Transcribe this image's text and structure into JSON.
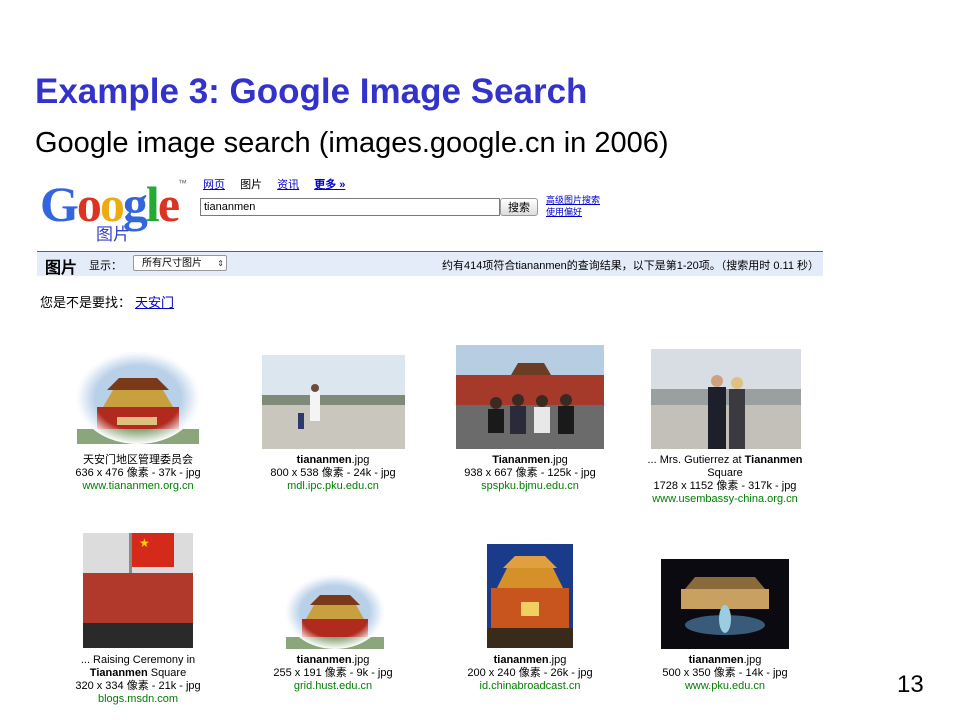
{
  "slide": {
    "title": "Example 3: Google Image Search",
    "subtitle": "Google image search (images.google.cn  in 2006)",
    "page_number": "13"
  },
  "logo": {
    "text": "Google",
    "subtitle": "图片",
    "tm": "™"
  },
  "tabs": {
    "web": "网页",
    "images": "图片",
    "news": "资讯",
    "more": "更多 »"
  },
  "search": {
    "query": "tiananmen",
    "button_label": "搜索"
  },
  "advanced": {
    "advanced_image_search": "高级图片搜索",
    "preferences": "使用偏好"
  },
  "results_bar": {
    "label": "图片",
    "show_label": "显示：",
    "size_filter": "所有尺寸图片",
    "stats": "约有414项符合tiananmen的查询结果，以下是第1-20项。（搜索用时 0.11 秒）"
  },
  "suggestion": {
    "prompt": "您是不是要找：",
    "link": "天安门"
  },
  "results": [
    {
      "l1": "天安门地区管理委员会",
      "l2": "636 x 476 像素 - 37k - jpg",
      "url": "www.tiananmen.org.cn"
    },
    {
      "l1b": "tiananmen",
      "l1": ".jpg",
      "l2": "800 x 538 像素 - 24k - jpg",
      "url": "mdl.ipc.pku.edu.cn"
    },
    {
      "l1b": "Tiananmen",
      "l1": ".jpg",
      "l2": "938 x 667 像素 - 125k - jpg",
      "url": "spspku.bjmu.edu.cn"
    },
    {
      "l1": "... Mrs. Gutierrez at ",
      "l1b": "Tiananmen",
      "l2": "Square",
      "l3": "1728 x 1152 像素 - 317k - jpg",
      "url": "www.usembassy-china.org.cn"
    },
    {
      "l1": "... Raising Ceremony in",
      "l2b": "Tiananmen",
      "l2": " Square",
      "l3": "320 x 334 像素 - 21k - jpg",
      "url": "blogs.msdn.com"
    },
    {
      "l1b": "tiananmen",
      "l1": ".jpg",
      "l2": "255 x 191 像素 - 9k - jpg",
      "url": "grid.hust.edu.cn"
    },
    {
      "l1b": "tiananmen",
      "l1": ".jpg",
      "l2": "200 x 240 像素 - 26k - jpg",
      "url": "id.chinabroadcast.cn"
    },
    {
      "l1b": "tiananmen",
      "l1": ".jpg",
      "l2": "500 x 350 像素 - 14k - jpg",
      "url": "www.pku.edu.cn"
    }
  ],
  "colors": {
    "title": "#3333cc",
    "link": "#0000cc",
    "url": "#008000",
    "bar": "#e5ecf9"
  }
}
